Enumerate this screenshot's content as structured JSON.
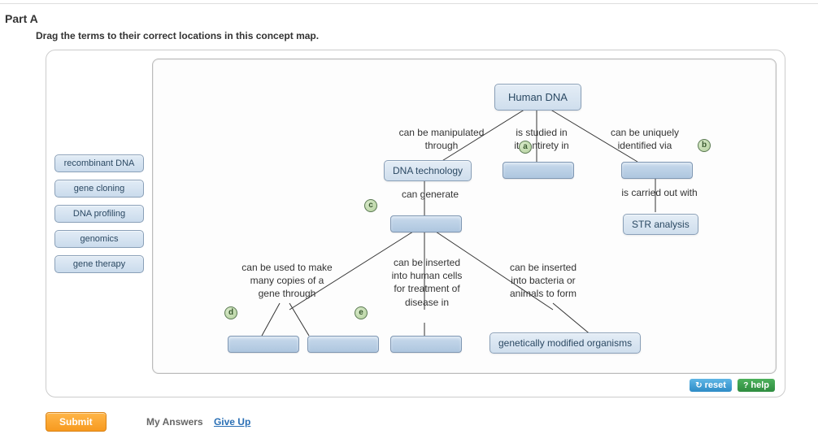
{
  "part_title": "Part A",
  "instructions": "Drag the terms to their correct locations in this concept map.",
  "terms": [
    "recombinant DNA",
    "gene cloning",
    "DNA profiling",
    "genomics",
    "gene therapy"
  ],
  "nodes": {
    "root": "Human DNA",
    "dna_tech": "DNA technology",
    "str": "STR analysis",
    "gmo": "genetically modified organisms"
  },
  "edges": {
    "manipulated": "can be manipulated\nthrough",
    "studied": "is studied in\nits entirety in",
    "uniquely": "can be uniquely\nidentified via",
    "can_generate": "can generate",
    "carried_out": "is carried out with",
    "copies": "can be used to make\nmany copies of a\ngene through",
    "inserted_cells": "can be inserted\ninto human cells\nfor treatment of\ndisease in",
    "inserted_bact": "can be inserted\ninto bacteria or\nanimals to form"
  },
  "badges": {
    "a": "a",
    "b": "b",
    "c": "c",
    "d": "d",
    "e": "e"
  },
  "toolbar": {
    "reset": "reset",
    "help": "help"
  },
  "footer": {
    "submit": "Submit",
    "my_answers": "My Answers",
    "give_up": "Give Up"
  }
}
